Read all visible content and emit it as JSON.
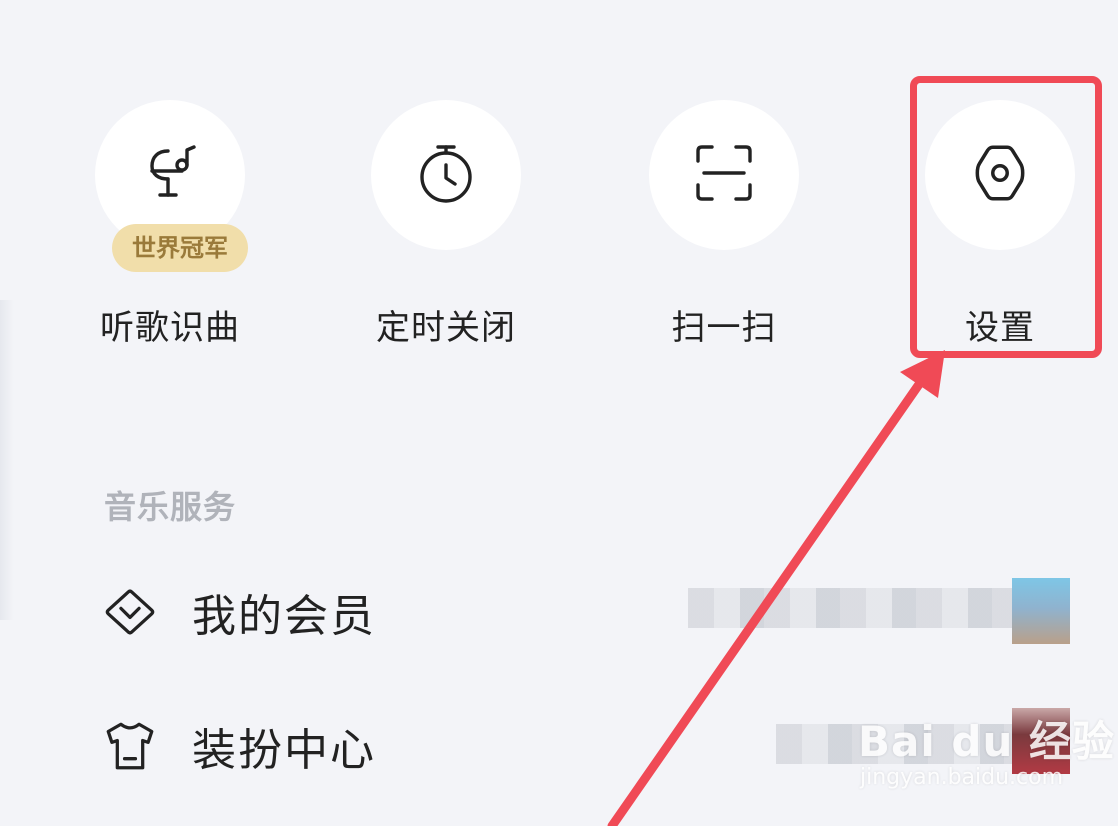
{
  "quick_actions": [
    {
      "label": "听歌识曲",
      "icon": "song-recognition-icon",
      "badge": "世界冠军"
    },
    {
      "label": "定时关闭",
      "icon": "timer-icon"
    },
    {
      "label": "扫一扫",
      "icon": "scan-icon"
    },
    {
      "label": "设置",
      "icon": "settings-gear-icon"
    }
  ],
  "music_services": {
    "title": "音乐服务",
    "items": [
      {
        "label": "我的会员",
        "icon": "diamond-icon"
      },
      {
        "label": "装扮中心",
        "icon": "tshirt-icon"
      }
    ]
  },
  "annotation": {
    "highlight_color": "#f04a56",
    "target": "设置"
  },
  "watermark": {
    "brand": "Bai du 经验",
    "url": "jingyan.baidu.com"
  },
  "colors": {
    "background": "#f3f4f8",
    "badge_bg": "#f1deaa",
    "badge_text": "#9a7a3a",
    "section_title": "#b0b3ba"
  }
}
